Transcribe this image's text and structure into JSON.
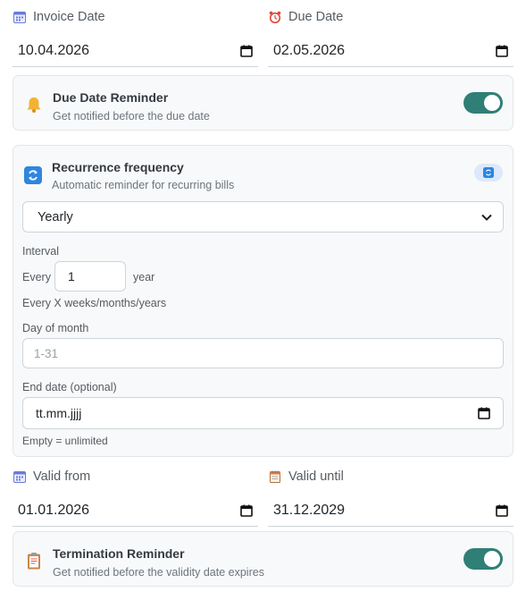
{
  "invoice_date": {
    "label": "Invoice Date",
    "value": "10.04.2026",
    "icon": "calendar-icon"
  },
  "due_date": {
    "label": "Due Date",
    "value": "02.05.2026",
    "icon": "alarm-clock-icon"
  },
  "due_reminder": {
    "title": "Due Date Reminder",
    "subtitle": "Get notified before the due date",
    "icon": "bell-icon",
    "enabled": true
  },
  "recurrence": {
    "title": "Recurrence frequency",
    "subtitle": "Automatic reminder for recurring bills",
    "icon": "repeat-icon",
    "frequency": "Yearly",
    "interval_label": "Interval",
    "every_label": "Every",
    "interval_value": "1",
    "unit_label": "year",
    "interval_hint": "Every X weeks/months/years",
    "day_label": "Day of month",
    "day_placeholder": "1-31",
    "end_label": "End date (optional)",
    "end_placeholder": "tt.mm.jjjj",
    "end_hint": "Empty = unlimited"
  },
  "valid_from": {
    "label": "Valid from",
    "value": "01.01.2026",
    "icon": "calendar-icon"
  },
  "valid_until": {
    "label": "Valid until",
    "value": "31.12.2029",
    "icon": "calendar-spiral-icon"
  },
  "termination_reminder": {
    "title": "Termination Reminder",
    "subtitle": "Get notified before the validity date expires",
    "icon": "clipboard-icon",
    "enabled": true
  },
  "colors": {
    "accent": "#2f7f76",
    "card_bg": "#f8f9fa",
    "border": "#ced4da"
  }
}
